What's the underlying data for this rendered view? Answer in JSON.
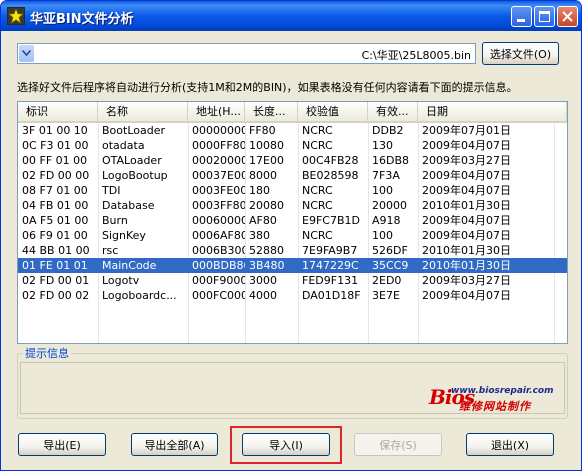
{
  "window": {
    "title": "华亚BIN文件分析",
    "icon": "star-app-icon"
  },
  "file": {
    "path": "C:\\华亚\\25L8005.bin",
    "choose_label": "选择文件(O)"
  },
  "hint_text": "选择好文件后程序将自动进行分析(支持1M和2M的BIN)，如果表格没有任何内容请看下面的提示信息。",
  "table": {
    "columns": [
      "标识",
      "名称",
      "地址(H...",
      "长度...",
      "校验值",
      "有效...",
      "日期"
    ],
    "rows": [
      [
        "3F 01 00 10",
        "BootLoader",
        "00000000",
        "FF80",
        "NCRC",
        "DDB2",
        "2009年07月01日"
      ],
      [
        "0C F3 01 00",
        "otadata",
        "0000FF80",
        "10080",
        "NCRC",
        "130",
        "2009年04月07日"
      ],
      [
        "00 FF 01 00",
        "OTALoader",
        "00020000",
        "17E00",
        "00C4FB28",
        "16DB8",
        "2009年03月27日"
      ],
      [
        "02 FD 00 00",
        "LogoBootup",
        "00037E00",
        "8000",
        "BE028598",
        "7F3A",
        "2009年04月07日"
      ],
      [
        "08 F7 01 00",
        "TDI",
        "0003FE00",
        "180",
        "NCRC",
        "100",
        "2009年04月07日"
      ],
      [
        "04 FB 01 00",
        "Database",
        "0003FF80",
        "20080",
        "NCRC",
        "20000",
        "2010年01月30日"
      ],
      [
        "0A F5 01 00",
        "Burn",
        "00060000",
        "AF80",
        "E9FC7B1D",
        "A918",
        "2009年04月07日"
      ],
      [
        "06 F9 01 00",
        "SignKey",
        "0006AF80",
        "380",
        "NCRC",
        "100",
        "2009年04月07日"
      ],
      [
        "44 BB 01 00",
        "rsc",
        "0006B300",
        "52880",
        "7E9FA9B7",
        "526DF",
        "2010年01月30日"
      ],
      [
        "01 FE 01 01",
        "MainCode",
        "000BDB80",
        "3B480",
        "1747229C",
        "35CC9",
        "2010年01月30日"
      ],
      [
        "02 FD 00 01",
        "Logotv",
        "000F9000",
        "3000",
        "FED9F131",
        "2ED0",
        "2009年03月27日"
      ],
      [
        "02 FD 00 02",
        "Logoboardc...",
        "000FC000",
        "4000",
        "DA01D18F",
        "3E7E",
        "2009年04月07日"
      ]
    ],
    "selected_row": 9
  },
  "info": {
    "label": "提示信息",
    "logo_url": "www.biosrepair.com",
    "logo_brand": "Bios",
    "logo_cn": "维修网站制作"
  },
  "buttons": {
    "export": "导出(E)",
    "export_all": "导出全部(A)",
    "import": "导入(I)",
    "save": "保存(S)",
    "exit": "退出(X)"
  },
  "colors": {
    "selection": "#316ac5",
    "highlight_box": "#e0242a",
    "titlebar": "#0a5ae8"
  }
}
